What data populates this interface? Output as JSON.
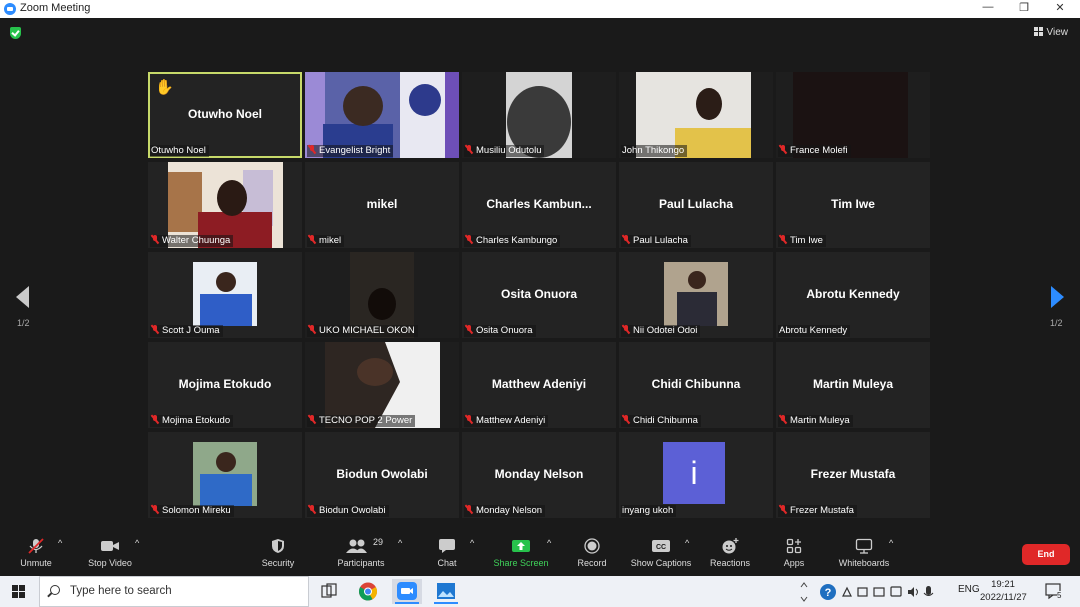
{
  "window": {
    "title": "Zoom Meeting",
    "minimize": "—",
    "maximize": "❐",
    "close": "✕"
  },
  "view_button": "View",
  "pager": {
    "left": "1/2",
    "right": "1/2"
  },
  "participants": [
    {
      "big": "Otuwho Noel",
      "label": "Otuwho Noel",
      "muted": false,
      "video": false,
      "raised_hand": true,
      "highlight": true
    },
    {
      "big": "",
      "label": "Evangelist Bright",
      "muted": true,
      "video": true
    },
    {
      "big": "",
      "label": "Musiliu Odutolu",
      "muted": true,
      "video": true
    },
    {
      "big": "",
      "label": "John Thikongo",
      "muted": false,
      "video": true
    },
    {
      "big": "",
      "label": "France Molefi",
      "muted": true,
      "video": true
    },
    {
      "big": "",
      "label": "Walter Chuunga",
      "muted": true,
      "video": true
    },
    {
      "big": "mikel",
      "label": "mikel",
      "muted": true,
      "video": false
    },
    {
      "big": "Charles  Kambun...",
      "label": "Charles Kambungo",
      "muted": true,
      "video": false
    },
    {
      "big": "Paul Lulacha",
      "label": "Paul Lulacha",
      "muted": true,
      "video": false
    },
    {
      "big": "Tim Iwe",
      "label": "Tim Iwe",
      "muted": true,
      "video": false
    },
    {
      "big": "",
      "label": "Scott J Ouma",
      "muted": true,
      "video": true
    },
    {
      "big": "",
      "label": "UKO MICHAEL OKON",
      "muted": true,
      "video": true
    },
    {
      "big": "Osita Onuora",
      "label": "Osita Onuora",
      "muted": true,
      "video": false
    },
    {
      "big": "",
      "label": "Nii Odotei Odoi",
      "muted": true,
      "video": true
    },
    {
      "big": "Abrotu Kennedy",
      "label": "Abrotu Kennedy",
      "muted": false,
      "video": false
    },
    {
      "big": "Mojima Etokudo",
      "label": "Mojima Etokudo",
      "muted": true,
      "video": false
    },
    {
      "big": "",
      "label": "TECNO POP 2 Power",
      "muted": true,
      "video": true
    },
    {
      "big": "Matthew Adeniyi",
      "label": "Matthew Adeniyi",
      "muted": true,
      "video": false
    },
    {
      "big": "Chidi Chibunna",
      "label": "Chidi Chibunna",
      "muted": true,
      "video": false
    },
    {
      "big": "Martin Muleya",
      "label": "Martin Muleya",
      "muted": true,
      "video": false
    },
    {
      "big": "",
      "label": "Solomon Mireku",
      "muted": true,
      "video": true
    },
    {
      "big": "Biodun Owolabi",
      "label": "Biodun Owolabi",
      "muted": true,
      "video": false
    },
    {
      "big": "Monday Nelson",
      "label": "Monday Nelson",
      "muted": true,
      "video": false
    },
    {
      "big": "",
      "label": "inyang ukoh",
      "muted": false,
      "video": false,
      "avatar_letter": "i"
    },
    {
      "big": "Frezer Mustafa",
      "label": "Frezer Mustafa",
      "muted": true,
      "video": false
    }
  ],
  "toolbar": {
    "unmute": "Unmute",
    "stop_video": "Stop Video",
    "security": "Security",
    "participants": "Participants",
    "participants_count": "29",
    "chat": "Chat",
    "share_screen": "Share Screen",
    "record": "Record",
    "show_captions": "Show Captions",
    "reactions": "Reactions",
    "apps": "Apps",
    "whiteboards": "Whiteboards",
    "end": "End"
  },
  "taskbar": {
    "search_placeholder": "Type here to search",
    "language": "ENG",
    "time": "19:21",
    "date": "2022/11/27",
    "notifications": "5"
  },
  "colors": {
    "accent": "#2d8cff",
    "end": "#e02828",
    "share": "#27c24c",
    "highlight": "#c7d96a"
  }
}
